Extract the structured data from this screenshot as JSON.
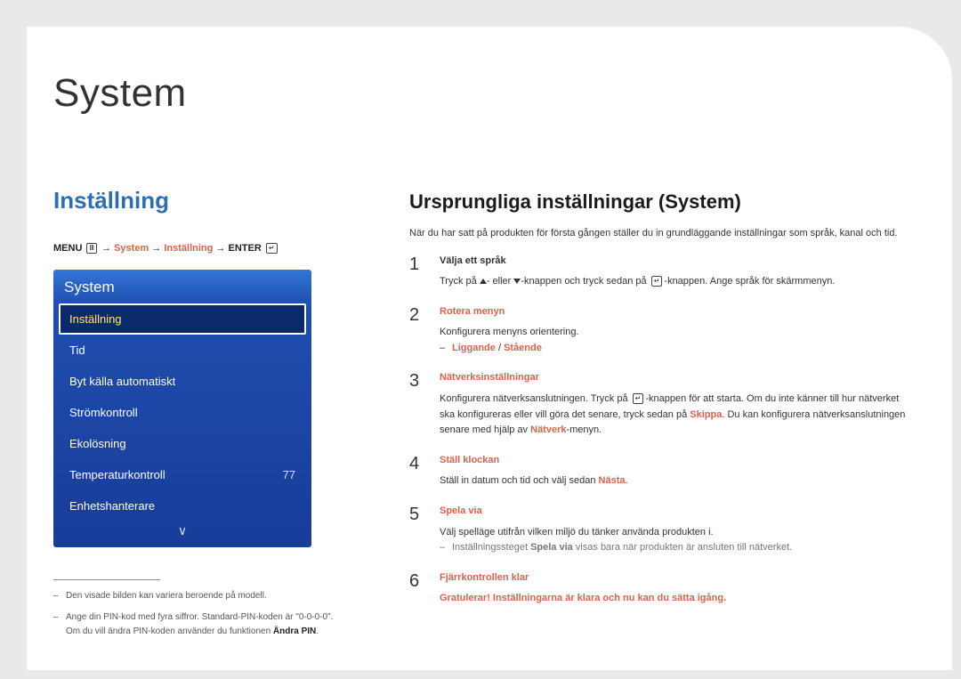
{
  "chapter": {
    "title": "System"
  },
  "left": {
    "heading": "Inställning",
    "breadcrumb": {
      "menu": "MENU",
      "arrow": "→",
      "system": "System",
      "setting": "Inställning",
      "enter": "ENTER"
    },
    "menu": {
      "title": "System",
      "items": [
        {
          "label": "Inställning",
          "value": ""
        },
        {
          "label": "Tid",
          "value": ""
        },
        {
          "label": "Byt källa automatiskt",
          "value": ""
        },
        {
          "label": "Strömkontroll",
          "value": ""
        },
        {
          "label": "Ekolösning",
          "value": ""
        },
        {
          "label": "Temperaturkontroll",
          "value": "77"
        },
        {
          "label": "Enhetshanterare",
          "value": ""
        }
      ],
      "more": "∨"
    },
    "footnotes": {
      "f1": "Den visade bilden kan variera beroende på modell.",
      "f2a": "Ange din PIN-kod med fyra siffror. Standard-PIN-koden är \"0-0-0-0\".",
      "f2b": "Om du vill ändra PIN-koden använder du funktionen ",
      "f2b_em": "Ändra PIN",
      "f2c": "."
    }
  },
  "right": {
    "heading": "Ursprungliga inställningar (System)",
    "intro": "När du har satt på produkten för första gången ställer du in grundläggande inställningar som språk, kanal och tid.",
    "steps": {
      "1": {
        "title": "Välja ett språk",
        "body_a": "Tryck på ",
        "body_b": "- eller ",
        "body_c": "-knappen och tryck sedan på ",
        "body_d": "-knappen. Ange språk för skärmmenyn."
      },
      "2": {
        "title": "Rotera menyn",
        "body": "Konfigurera menyns orientering.",
        "sub_a": "Liggande",
        "sub_sep": " / ",
        "sub_b": "Stående"
      },
      "3": {
        "title": "Nätverksinställningar",
        "body_a": "Konfigurera nätverksanslutningen. Tryck på ",
        "body_b": "-knappen för att starta. Om du inte känner till hur nätverket ska konfigureras eller vill göra det senare, tryck sedan på ",
        "skip": "Skippa",
        "body_c": ". Du kan konfigurera nätverksanslutningen senare med hjälp av ",
        "net": "Nätverk",
        "body_d": "-menyn."
      },
      "4": {
        "title": "Ställ klockan",
        "body_a": "Ställ in datum och tid och välj sedan ",
        "next": "Nästa",
        "body_b": "."
      },
      "5": {
        "title": "Spela via",
        "body": "Välj spelläge utifrån vilken miljö du tänker använda produkten i.",
        "sub_a": "Inställningssteget ",
        "sub_em": "Spela via",
        "sub_b": " visas bara när produkten är ansluten till nätverket."
      },
      "6": {
        "title": "Fjärrkontrollen klar",
        "final": "Gratulerar! Inställningarna är klara och nu kan du sätta igång."
      }
    }
  }
}
